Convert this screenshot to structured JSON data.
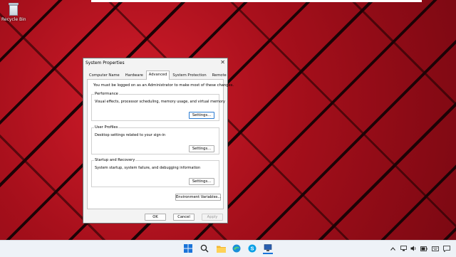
{
  "desktop": {
    "recycle_bin_label": "Recycle Bin"
  },
  "dialog": {
    "title": "System Properties",
    "tabs": [
      {
        "label": "Computer Name"
      },
      {
        "label": "Hardware"
      },
      {
        "label": "Advanced"
      },
      {
        "label": "System Protection"
      },
      {
        "label": "Remote"
      }
    ],
    "active_tab": "Advanced",
    "notice": "You must be logged on as an Administrator to make most of these changes.",
    "groups": {
      "performance": {
        "title": "Performance",
        "description": "Visual effects, processor scheduling, memory usage, and virtual memory",
        "button": "Settings..."
      },
      "user_profiles": {
        "title": "User Profiles",
        "description": "Desktop settings related to your sign-in",
        "button": "Settings..."
      },
      "startup_recovery": {
        "title": "Startup and Recovery",
        "description": "System startup, system failure, and debugging information",
        "button": "Settings..."
      }
    },
    "env_button": "Environment Variables...",
    "ok": "OK",
    "cancel": "Cancel",
    "apply": "Apply"
  },
  "taskbar": {
    "icons": [
      "windows-start-icon",
      "search-icon",
      "file-explorer-icon",
      "edge-browser-icon",
      "skype-icon",
      "system-properties-app-icon"
    ],
    "tray": [
      "chevron-up-icon",
      "network-icon",
      "volume-icon",
      "battery-icon",
      "keyboard-icon",
      "notification-icon"
    ]
  }
}
